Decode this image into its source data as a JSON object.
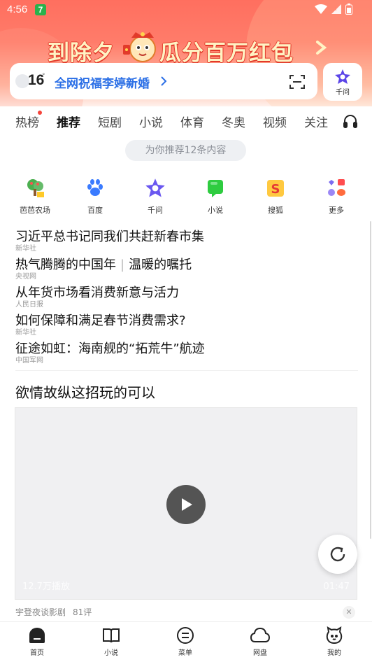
{
  "status_bar": {
    "time": "4:56",
    "app_badge": "7"
  },
  "banner": {
    "left_text": "到除夕",
    "right_text": "瓜分百万红包"
  },
  "search": {
    "temperature": "16",
    "degree_symbol": "°",
    "hint": "全网祝福李婷新婚"
  },
  "qianwen_button": {
    "label": "千问"
  },
  "tabs": [
    "热榜",
    "推荐",
    "短剧",
    "小说",
    "体育",
    "冬奥",
    "视频",
    "关注"
  ],
  "active_tab": "推荐",
  "recommend_pill": "为你推荐12条内容",
  "apps": [
    "芭芭农场",
    "百度",
    "千问",
    "小说",
    "搜狐",
    "更多"
  ],
  "news": [
    {
      "title": "习近平总书记同我们共赶新春市集",
      "source": "新华社"
    },
    {
      "title_a": "热气腾腾的中国年",
      "separator": "|",
      "title_b": "温暖的嘱托",
      "source": "央视网"
    },
    {
      "title": "从年货市场看消费新意与活力",
      "source": "人民日报"
    },
    {
      "title": "如何保障和满足春节消费需求?",
      "source": "新华社"
    },
    {
      "title": "征途如虹：海南舰的“拓荒牛”航迹",
      "source": "中国军网"
    }
  ],
  "video": {
    "title": "欲情故纵这招玩的可以",
    "views": "12.7万播放",
    "duration": "01:47",
    "author": "宇登夜谈影剧",
    "comments": "81评"
  },
  "bottom_nav": [
    "首页",
    "小说",
    "菜单",
    "网盘",
    "我的"
  ],
  "colors": {
    "accent_blue": "#2b6fe6",
    "header_red": "#ff6f5f",
    "dot_red": "#f5443a"
  }
}
